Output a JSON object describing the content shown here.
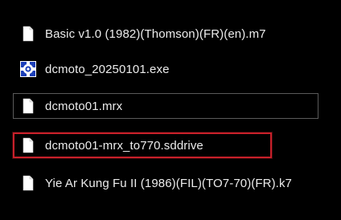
{
  "files": [
    {
      "name": "Basic v1.0 (1982)(Thomson)(FR)(en).m7",
      "icon": "document-icon"
    },
    {
      "name": "dcmoto_20250101.exe",
      "icon": "app-exe-icon"
    },
    {
      "name": "dcmoto01.mrx",
      "icon": "document-icon"
    },
    {
      "name": "dcmoto01-mrx_to770.sddrive",
      "icon": "document-icon"
    },
    {
      "name": "Yie Ar Kung Fu II (1986)(FIL)(TO7-70)(FR).k7",
      "icon": "document-icon"
    }
  ],
  "colors": {
    "background": "#000000",
    "text": "#ececec",
    "highlight_border": "#c8202a",
    "focus_border": "#5a5a5a"
  }
}
